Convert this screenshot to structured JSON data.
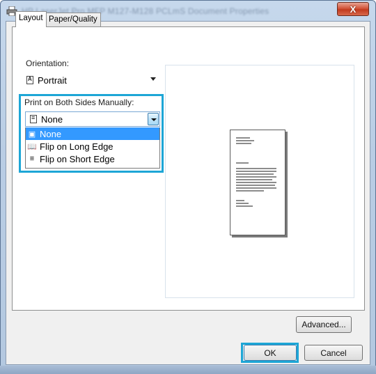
{
  "window": {
    "title": "HP LaserJet Pro MFP M127-M128 PCLmS Document Properties",
    "close_label": "X"
  },
  "tabs": [
    {
      "label": "Layout"
    },
    {
      "label": "Paper/Quality"
    }
  ],
  "orientation": {
    "label": "Orientation:",
    "value": "Portrait"
  },
  "duplex": {
    "label": "Print on Both Sides Manually:",
    "value": "None",
    "options": [
      "None",
      "Flip on Long Edge",
      "Flip on Short Edge"
    ],
    "selected_index": 0
  },
  "buttons": {
    "advanced": "Advanced...",
    "ok": "OK",
    "cancel": "Cancel"
  },
  "colors": {
    "highlight": "#1da6d6",
    "selection": "#3399ff"
  }
}
